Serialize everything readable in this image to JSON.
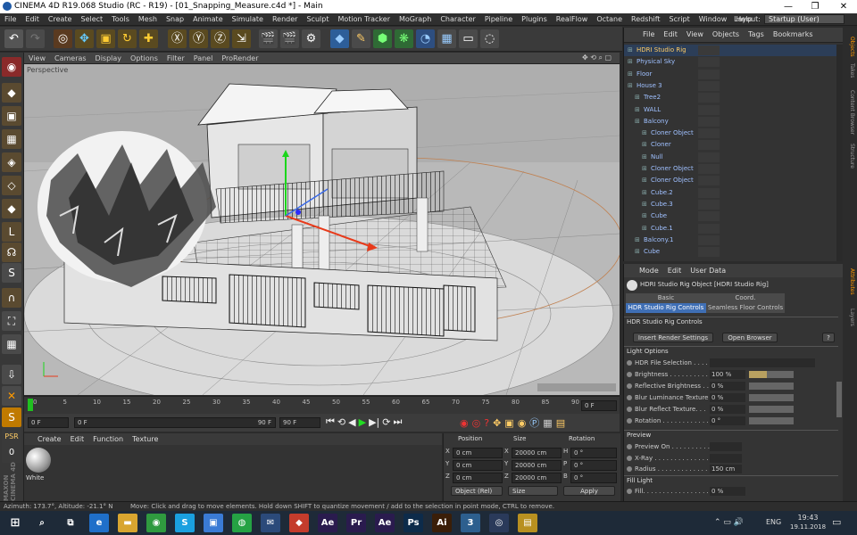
{
  "window": {
    "title": "CINEMA 4D R19.068 Studio (RC - R19) - [01_Snapping_Measure.c4d *] - Main"
  },
  "menu": [
    "File",
    "Edit",
    "Create",
    "Select",
    "Tools",
    "Mesh",
    "Snap",
    "Animate",
    "Simulate",
    "Render",
    "Sculpt",
    "Motion Tracker",
    "MoGraph",
    "Character",
    "Pipeline",
    "Plugins",
    "RealFlow",
    "Octane",
    "Redshift",
    "Script",
    "Window",
    "Help"
  ],
  "layout": {
    "label": "Layout:",
    "value": "Startup (User)"
  },
  "viewport": {
    "menu": [
      "View",
      "Cameras",
      "Display",
      "Options",
      "Filter",
      "Panel",
      "ProRender"
    ],
    "label": "Perspective"
  },
  "timeline": {
    "ticks": [
      "0",
      "5",
      "10",
      "15",
      "20",
      "25",
      "30",
      "35",
      "40",
      "45",
      "50",
      "55",
      "60",
      "65",
      "70",
      "75",
      "80",
      "85",
      "90"
    ],
    "end_field": "0 F"
  },
  "timectrl": {
    "start": "0 F",
    "current": "0 F",
    "range_end": "90 F",
    "end": "90 F"
  },
  "material_manager": {
    "menu": [
      "Create",
      "Edit",
      "Function",
      "Texture"
    ],
    "material_name": "White"
  },
  "coordinates": {
    "headers": [
      "Position",
      "Size",
      "Rotation"
    ],
    "rows": [
      {
        "axis": "X",
        "pos": "0 cm",
        "size_axis": "X",
        "size": "20000 cm",
        "rot_axis": "H",
        "rot": "0 °"
      },
      {
        "axis": "Y",
        "pos": "0 cm",
        "size_axis": "Y",
        "size": "20000 cm",
        "rot_axis": "P",
        "rot": "0 °"
      },
      {
        "axis": "Z",
        "pos": "0 cm",
        "size_axis": "Z",
        "size": "20000 cm",
        "rot_axis": "B",
        "rot": "0 °"
      }
    ],
    "mode": "Object (Rel)",
    "size_mode": "Size",
    "apply": "Apply"
  },
  "object_manager": {
    "menu": [
      "File",
      "Edit",
      "View",
      "Objects",
      "Tags",
      "Bookmarks"
    ],
    "objects": [
      {
        "name": "HDRI Studio Rig",
        "depth": 0,
        "selected": true,
        "color": "#ffcc66"
      },
      {
        "name": "Physical Sky",
        "depth": 0,
        "color": "#9fc0ff"
      },
      {
        "name": "Floor",
        "depth": 0,
        "color": "#9fc0ff"
      },
      {
        "name": "House 3",
        "depth": 0,
        "color": "#9fc0ff"
      },
      {
        "name": "Tree2",
        "depth": 1,
        "color": "#9fc0ff"
      },
      {
        "name": "WALL",
        "depth": 1,
        "color": "#9fc0ff"
      },
      {
        "name": "Balcony",
        "depth": 1,
        "color": "#9fc0ff"
      },
      {
        "name": "Cloner Object",
        "depth": 2,
        "color": "#9fc0ff"
      },
      {
        "name": "Cloner",
        "depth": 2,
        "color": "#9fc0ff"
      },
      {
        "name": "Null",
        "depth": 2,
        "color": "#9fc0ff"
      },
      {
        "name": "Cloner Object",
        "depth": 2,
        "color": "#9fc0ff"
      },
      {
        "name": "Cloner Object",
        "depth": 2,
        "color": "#9fc0ff"
      },
      {
        "name": "Cube.2",
        "depth": 2,
        "color": "#9fc0ff"
      },
      {
        "name": "Cube.3",
        "depth": 2,
        "color": "#9fc0ff"
      },
      {
        "name": "Cube",
        "depth": 2,
        "color": "#9fc0ff"
      },
      {
        "name": "Cube.1",
        "depth": 2,
        "color": "#9fc0ff"
      },
      {
        "name": "Balcony.1",
        "depth": 1,
        "color": "#9fc0ff"
      },
      {
        "name": "Cube",
        "depth": 1,
        "color": "#9fc0ff"
      }
    ]
  },
  "attributes": {
    "menu": [
      "Mode",
      "Edit",
      "User Data"
    ],
    "object_title": "HDRI Studio Rig Object [HDRI Studio Rig]",
    "tabs": [
      "Basic",
      "Coord.",
      "HDR Studio Rig Controls",
      "Seamless Floor Controls"
    ],
    "group_title": "HDR Studio Rig Controls",
    "insert_render": "Insert Render Settings",
    "open_browser": "Open Browser",
    "light_options": "Light Options",
    "props": [
      {
        "label": "HDR File Selection . . . . .",
        "value": "",
        "fill": 0
      },
      {
        "label": "Brightness . . . . . . . . . . .",
        "value": "100 %",
        "fill": 0.4
      },
      {
        "label": "Reflective Brightness . .",
        "value": "0 %",
        "fill": 0
      },
      {
        "label": "Blur Luminance Texture",
        "value": "0 %",
        "fill": 0
      },
      {
        "label": "Blur Reflect Texture. . .",
        "value": "0 %",
        "fill": 0
      },
      {
        "label": "Rotation . . . . . . . . . . . .",
        "value": "0 °",
        "fill": 0
      }
    ],
    "preview": "Preview",
    "preview_props": [
      {
        "label": "Preview On . . . . . . . . . .",
        "value": ""
      },
      {
        "label": "X-Ray . . . . . . . . . . . . . .",
        "value": ""
      },
      {
        "label": "Radius . . . . . . . . . . . . . .",
        "value": "150 cm"
      }
    ],
    "fill_light": "Fill Light",
    "fill_props": [
      {
        "label": "Fill. . . . . . . . . . . . . . . . . .",
        "value": "0 %"
      }
    ]
  },
  "side_tabs": [
    "Objects",
    "Takes",
    "Content Browser",
    "Structure",
    "Attributes",
    "Layers"
  ],
  "status": {
    "left": "Azimuth: 173.7°, Altitude: -21.1°  N",
    "right": "Move: Click and drag to move elements. Hold down SHIFT to quantize movement / add to the selection in point mode, CTRL to remove."
  },
  "taskbar": {
    "apps": [
      {
        "name": "search-icon",
        "label": "⌕",
        "bg": "transparent"
      },
      {
        "name": "task-view-icon",
        "label": "⧉",
        "bg": "transparent"
      },
      {
        "name": "edge-icon",
        "label": "e",
        "bg": "#1f6fc9"
      },
      {
        "name": "explorer-icon",
        "label": "▬",
        "bg": "#d8a530"
      },
      {
        "name": "chrome-icon",
        "label": "◉",
        "bg": "#2f9a3f"
      },
      {
        "name": "skype-icon",
        "label": "S",
        "bg": "#1aa0e0"
      },
      {
        "name": "store-icon",
        "label": "▣",
        "bg": "#3a7bd5"
      },
      {
        "name": "whatsapp-icon",
        "label": "◍",
        "bg": "#25a244"
      },
      {
        "name": "mail-icon",
        "label": "✉",
        "bg": "#2b4a7a"
      },
      {
        "name": "app-icon",
        "label": "◆",
        "bg": "#c43c2c"
      },
      {
        "name": "after-effects-icon",
        "label": "Ae",
        "bg": "#2a1b4e"
      },
      {
        "name": "premiere-icon",
        "label": "Pr",
        "bg": "#2a1b4e"
      },
      {
        "name": "after-effects-2-icon",
        "label": "Ae",
        "bg": "#2a1b4e"
      },
      {
        "name": "photoshop-icon",
        "label": "Ps",
        "bg": "#0d2b4a"
      },
      {
        "name": "illustrator-icon",
        "label": "Ai",
        "bg": "#3a1e08"
      },
      {
        "name": "cinema-app-icon",
        "label": "3",
        "bg": "#2d5f8e"
      },
      {
        "name": "cinema4d-icon",
        "label": "◎",
        "bg": "#2a3a5a"
      },
      {
        "name": "archive-icon",
        "label": "▤",
        "bg": "#b89020"
      }
    ],
    "tray": {
      "lang": "ENG",
      "time": "19:43",
      "date": "19.11.2018"
    }
  }
}
